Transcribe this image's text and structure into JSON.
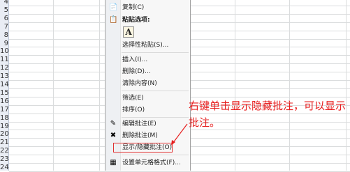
{
  "sheet": {
    "row_numbers": [
      "4",
      "5",
      "6",
      "7",
      "8",
      "9",
      "10",
      "11",
      "12",
      "13",
      "14",
      "15",
      "16",
      "17",
      "18",
      "19",
      "20",
      "21",
      "22",
      "23",
      "24"
    ]
  },
  "context_menu": {
    "copy": "复制(C)",
    "paste_options_header": "粘贴选项:",
    "paste_special": "选择性粘贴(S)...",
    "insert": "插入(I)...",
    "delete": "删除(D)...",
    "clear_contents": "清除内容(N)",
    "filter": "筛选(E)",
    "sort": "排序(O)",
    "edit_comment": "编辑批注(E)",
    "delete_comment": "删除批注(M)",
    "show_hide_comments": "显示/隐藏批注(O)",
    "format_cells": "设置单元格格式(F)..."
  },
  "annotation": {
    "text": "右键单击显示隐藏批注，可以显示批注。"
  },
  "colors": {
    "annotation": "#e61e1e",
    "highlight_box": "#e03030"
  }
}
